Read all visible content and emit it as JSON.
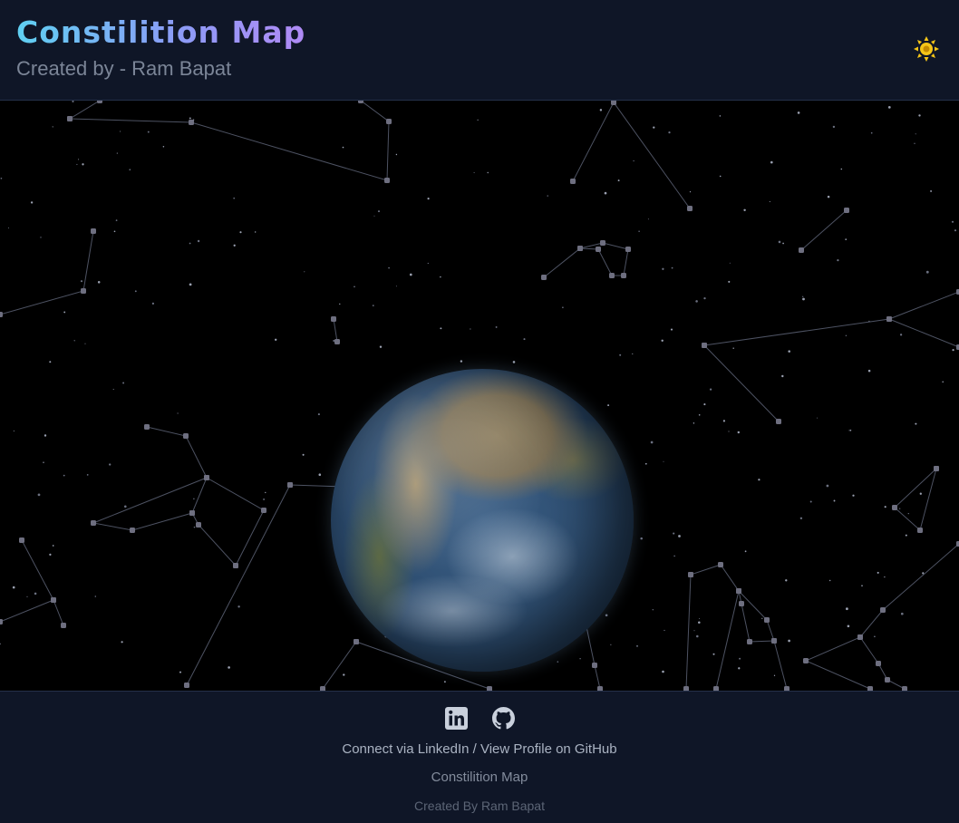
{
  "header": {
    "title": "Constilition Map",
    "subtitle": "Created by - Ram Bapat",
    "theme_icon": "sun-icon"
  },
  "sky": {
    "background": "#000000",
    "star_color": "#8a8fa0",
    "line_color": "#5a5f70",
    "globe": "earth"
  },
  "footer": {
    "icons": [
      "linkedin-icon",
      "github-icon"
    ],
    "linkedin_text": "Connect via LinkedIn",
    "separator": "/",
    "github_text": "View Profile on GitHub",
    "site_name": "Constilition Map",
    "credit": "Created By Ram Bapat"
  },
  "colors": {
    "background": "#0f1627",
    "title_gradient_start": "#5fd0f2",
    "title_gradient_end": "#b08af5",
    "sun": "#f5c518"
  }
}
